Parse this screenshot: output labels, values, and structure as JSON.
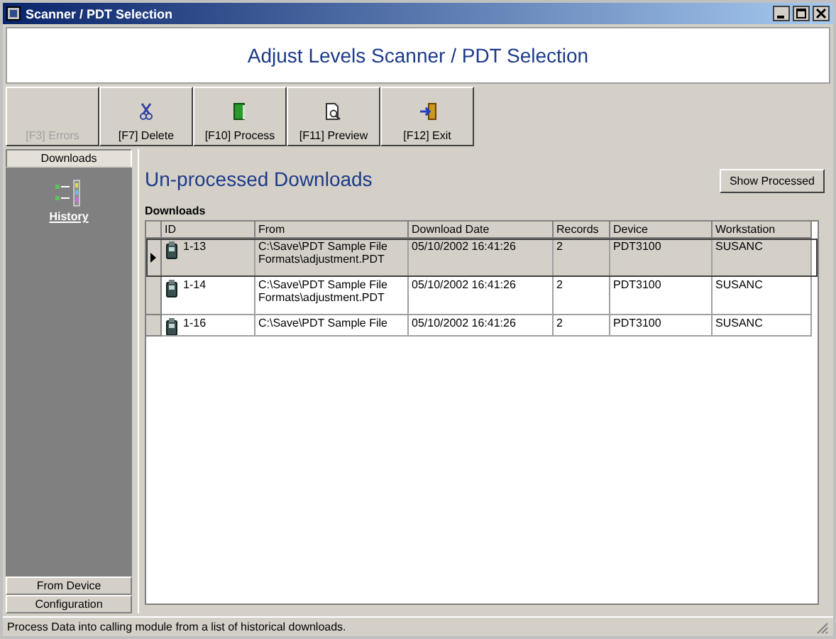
{
  "window": {
    "title": "Scanner / PDT Selection"
  },
  "header": {
    "title": "Adjust Levels Scanner / PDT Selection"
  },
  "toolbar": [
    {
      "label": "[F3] Errors",
      "disabled": true
    },
    {
      "label": "[F7] Delete",
      "disabled": false
    },
    {
      "label": "[F10] Process",
      "disabled": false
    },
    {
      "label": "[F11] Preview",
      "disabled": false
    },
    {
      "label": "[F12] Exit",
      "disabled": false
    }
  ],
  "sidebar": {
    "sections": [
      {
        "label": "Downloads",
        "selected": true
      },
      {
        "label": "From Device",
        "selected": false
      },
      {
        "label": "Configuration",
        "selected": false
      }
    ],
    "items": [
      {
        "label": "History"
      }
    ]
  },
  "content": {
    "title": "Un-processed Downloads",
    "show_processed_button": "Show Processed",
    "table_label": "Downloads",
    "columns": [
      "ID",
      "From",
      "Download Date",
      "Records",
      "Device",
      "Workstation"
    ],
    "rows": [
      {
        "selected": true,
        "cells": [
          "1-13",
          "C:\\Save\\PDT Sample File Formats\\adjustment.PDT",
          "05/10/2002 16:41:26",
          "2",
          "PDT3100",
          "SUSANC"
        ]
      },
      {
        "selected": false,
        "cells": [
          "1-14",
          "C:\\Save\\PDT Sample File Formats\\adjustment.PDT",
          "05/10/2002 16:41:26",
          "2",
          "PDT3100",
          "SUSANC"
        ]
      },
      {
        "selected": false,
        "cells": [
          "1-16",
          "C:\\Save\\PDT Sample File",
          "05/10/2002 16:41:26",
          "2",
          "PDT3100",
          "SUSANC"
        ]
      }
    ]
  },
  "status_bar": "Process Data into calling module from a list of historical downloads."
}
